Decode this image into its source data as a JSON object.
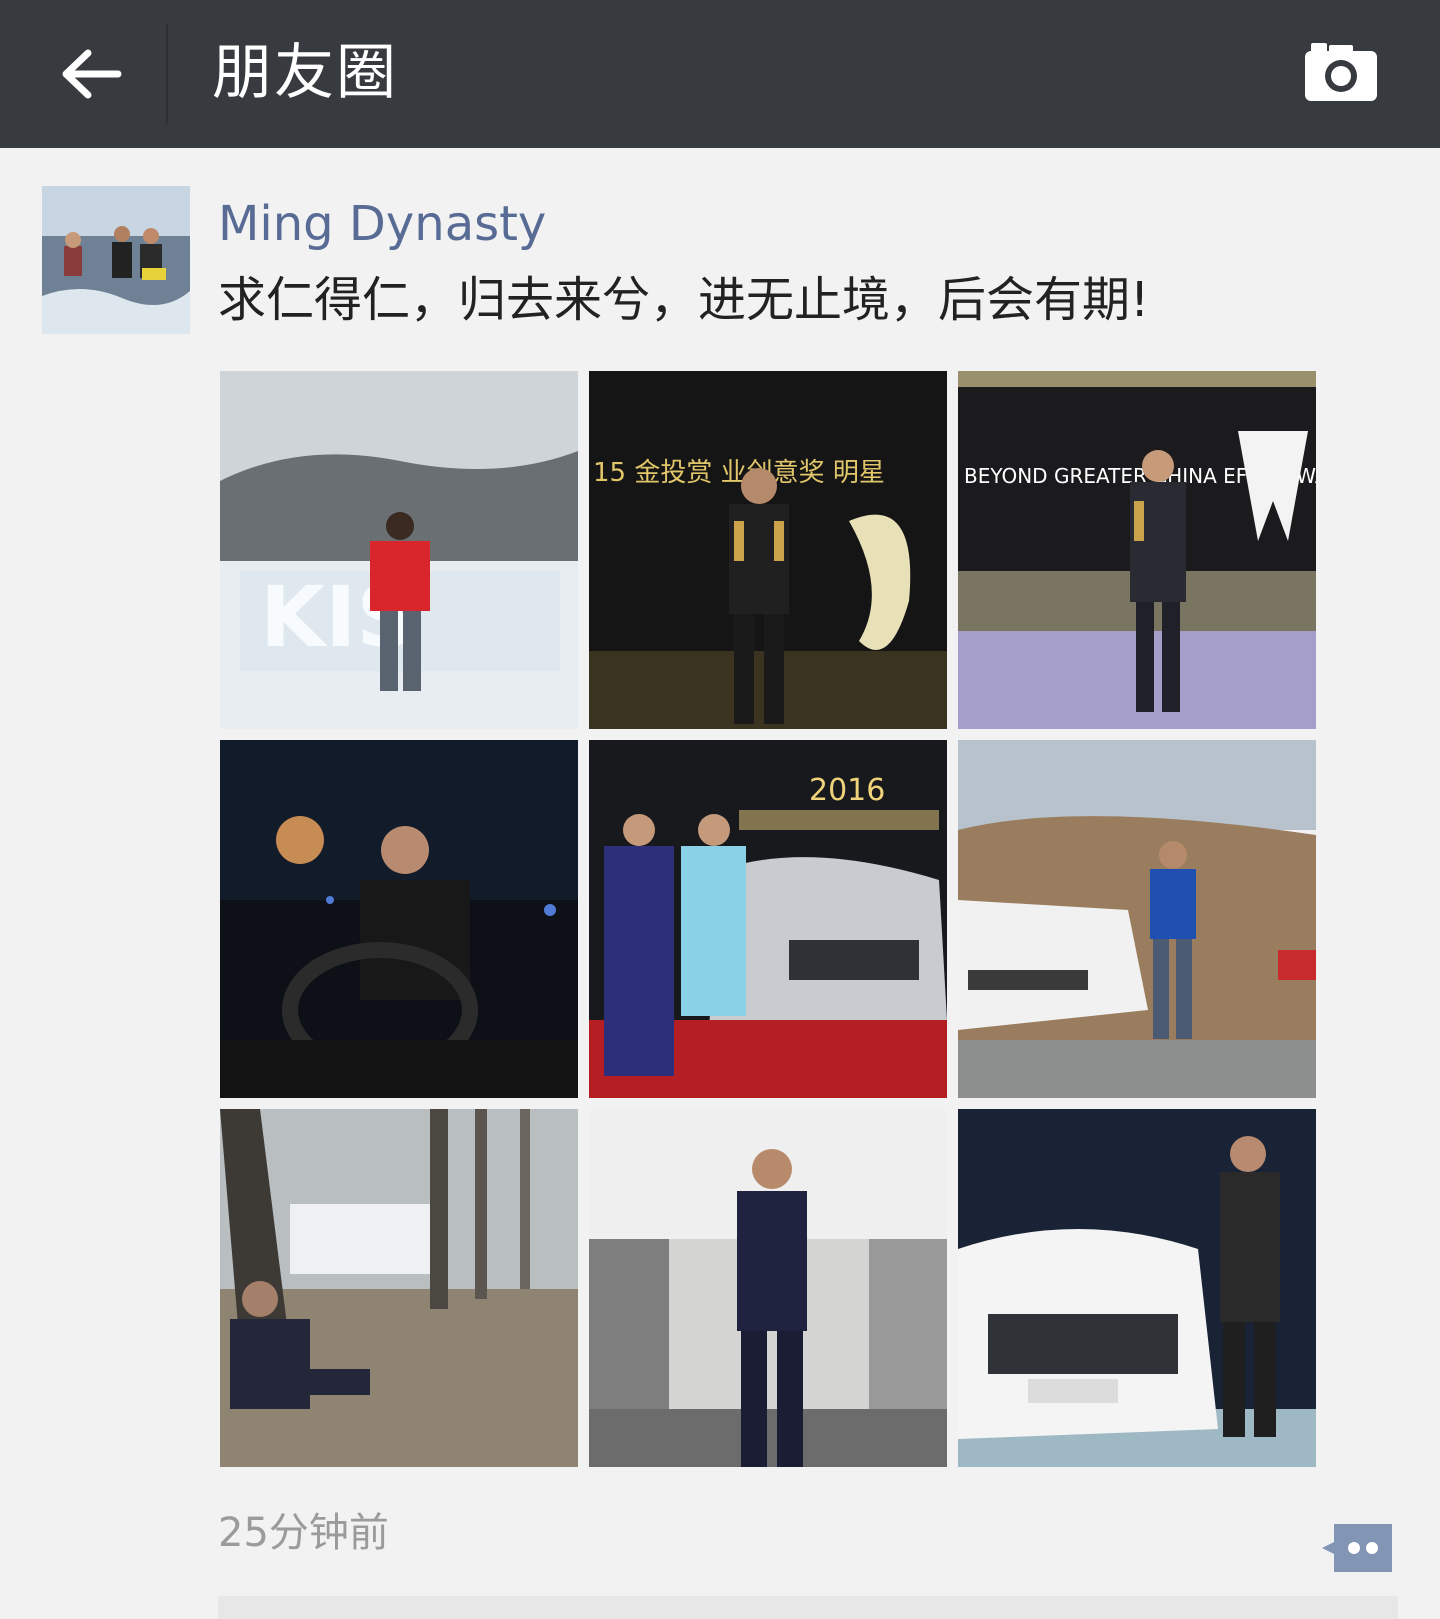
{
  "header": {
    "back_icon": "arrow-left-icon",
    "title": "朋友圈",
    "camera_icon": "camera-icon",
    "background": "#373b40"
  },
  "post": {
    "username": "Ming Dynasty",
    "username_color": "#576b95",
    "text": "求仁得仁，归去来兮，进无止境，后会有期!",
    "photos": [
      {
        "caption": "KIS"
      },
      {
        "caption": "15 金投赏 业创意奖 明星"
      },
      {
        "caption": "BEYOND GREATER CHINA EFFIE AWARDS"
      },
      {
        "caption": ""
      },
      {
        "caption": "2016"
      },
      {
        "caption": ""
      },
      {
        "caption": ""
      },
      {
        "caption": ""
      },
      {
        "caption": ""
      }
    ],
    "timestamp": "25分钟前",
    "comment_icon": "comment-dots-icon"
  }
}
